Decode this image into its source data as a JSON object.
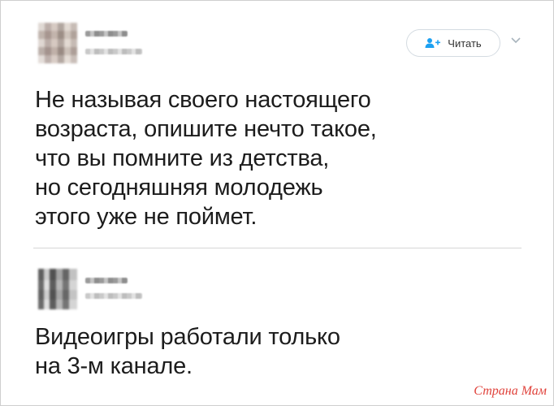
{
  "tweets": [
    {
      "follow_label": "Читать",
      "text_lines": [
        "Не называя своего настоящего",
        "возраста, опишите нечто такое,",
        "что вы помните из детства,",
        "но сегодняшняя молодежь",
        "этого уже не поймет."
      ]
    },
    {
      "text_lines": [
        "Видеоигры работали только",
        "на 3-м канале."
      ]
    }
  ],
  "watermark": "Страна Мам",
  "colors": {
    "text": "#1c1c1c",
    "follow_icon": "#1da1f2",
    "watermark": "#e0433c"
  },
  "icons": {
    "follow": "add-user-icon",
    "menu": "chevron-down-icon"
  }
}
